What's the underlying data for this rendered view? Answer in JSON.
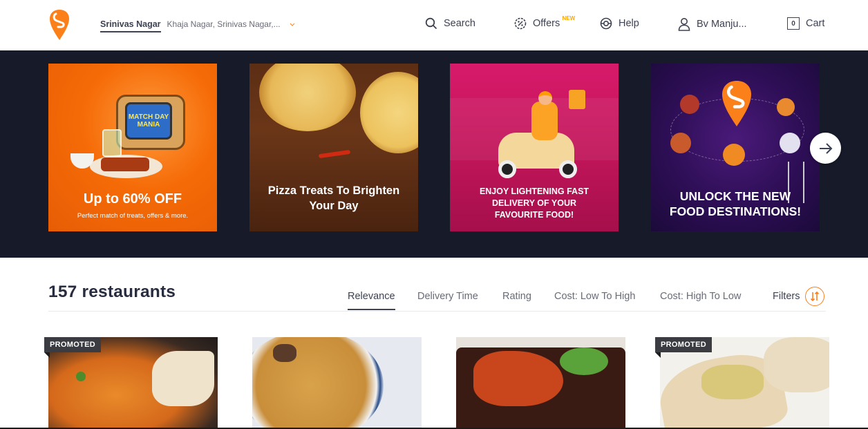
{
  "header": {
    "location_main": "Srinivas Nagar",
    "location_sub": "Khaja Nagar, Srinivas Nagar,...",
    "nav": {
      "search": "Search",
      "offers": "Offers",
      "offers_badge": "NEW",
      "help": "Help",
      "account": "Bv Manju...",
      "cart": "Cart",
      "cart_count": "0"
    },
    "icons": [
      "swiggy-logo-icon",
      "chevron-down-icon",
      "search-icon",
      "offers-icon",
      "help-icon",
      "user-icon",
      "cart-icon"
    ]
  },
  "carousel": {
    "cards": [
      {
        "title": "Up to 60% OFF",
        "subtitle": "Perfect match of treats, offers & more.",
        "tv_text": "MATCH DAY MANIA"
      },
      {
        "title_line1": "Pizza Treats To Brighten",
        "title_line2": "Your Day"
      },
      {
        "line1": "ENJOY LIGHTENING FAST",
        "line2": "DELIVERY OF YOUR",
        "line3": "FAVOURITE FOOD!"
      },
      {
        "line1": "UNLOCK THE NEW",
        "line2": "FOOD DESTINATIONS!"
      }
    ],
    "next_icon": "arrow-right-icon"
  },
  "listing": {
    "count": "157 restaurants",
    "sorts": [
      "Relevance",
      "Delivery Time",
      "Rating",
      "Cost: Low To High",
      "Cost: High To Low"
    ],
    "active_sort": "Relevance",
    "filters": "Filters",
    "promoted_label": "PROMOTED",
    "tiles": [
      {
        "dish": "paneer-curry",
        "promoted": true
      },
      {
        "dish": "biryani",
        "promoted": false
      },
      {
        "dish": "tandoori-chicken",
        "promoted": false
      },
      {
        "dish": "wrap-roll",
        "promoted": true
      }
    ]
  },
  "colors": {
    "brand": "#fc8019",
    "band": "#171a29",
    "text": "#3d4152",
    "muted": "#686b78",
    "badge": "#ffa700"
  }
}
